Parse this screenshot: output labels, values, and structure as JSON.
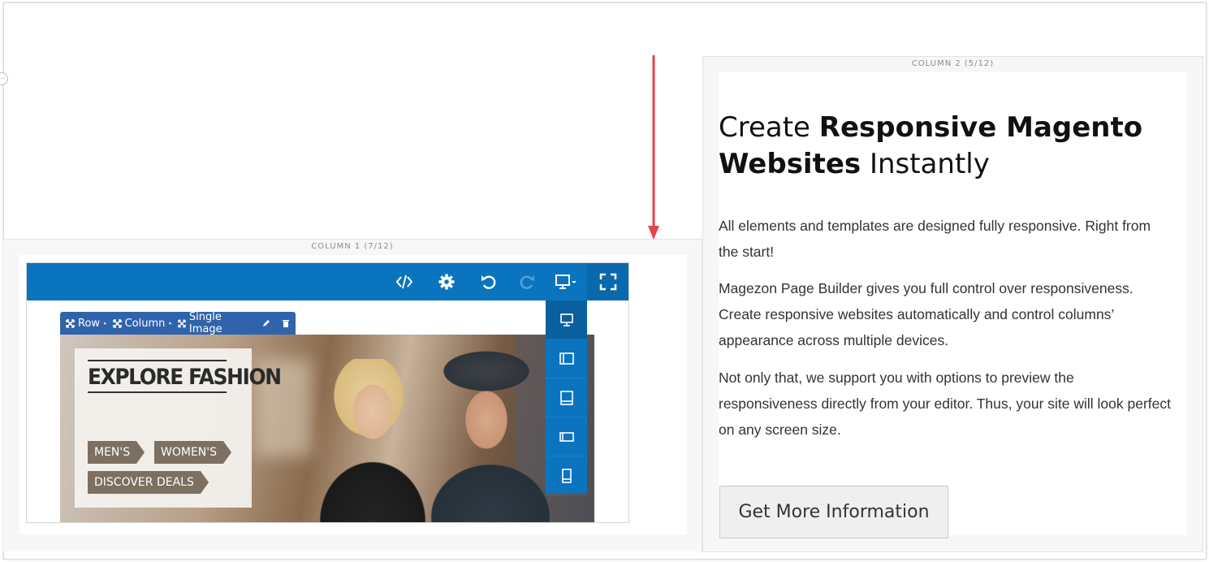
{
  "column1": {
    "label": "COLUMN 1 (7/12)"
  },
  "column2": {
    "label": "COLUMN 2 (5/12)"
  },
  "toolbar": {
    "icons": [
      "code-icon",
      "gear-icon",
      "undo-icon",
      "redo-icon",
      "monitor-dropdown-icon",
      "fullscreen-icon"
    ],
    "accent": "#0b74bf"
  },
  "device_menu": {
    "items": [
      "desktop-icon",
      "tablet-landscape-icon",
      "tablet-portrait-icon",
      "mobile-landscape-icon",
      "mobile-portrait-icon"
    ]
  },
  "breadcrumb": {
    "items": [
      {
        "label": "Row"
      },
      {
        "label": "Column"
      },
      {
        "label": "Single Image"
      }
    ]
  },
  "promo": {
    "title": "EXPLORE FASHION",
    "tags": [
      "MEN'S",
      "WOMEN'S",
      "DISCOVER DEALS"
    ]
  },
  "content": {
    "headline_1": "Create ",
    "headline_bold": "Responsive Magento Websites",
    "headline_2": " Instantly",
    "paragraphs": [
      "All elements and templates are designed fully responsive. Right from the start!",
      "Magezon Page Builder gives you full control over responsiveness. Create responsive websites automatically and control columns’ appearance across multiple devices.",
      "Not only that, we support you with options to preview the responsiveness directly from your editor. Thus, your site will look perfect on any screen size."
    ],
    "cta_label": "Get More Information"
  },
  "annotation": {
    "arrow_color": "#e8424a"
  }
}
